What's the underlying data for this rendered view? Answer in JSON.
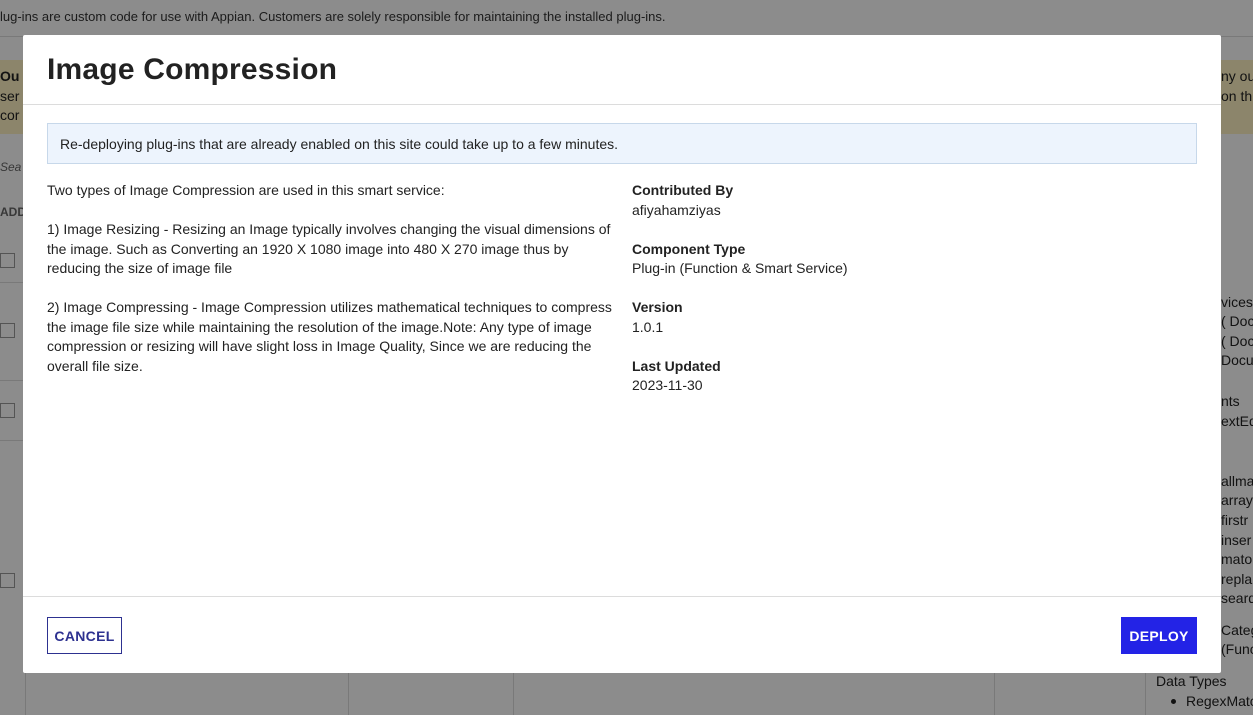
{
  "background": {
    "description": "lug-ins are custom code for use with Appian. Customers are solely responsible for maintaining the installed plug-ins.",
    "left_fragments": [
      "Ou",
      "ser",
      "cor",
      "Sea",
      "ADD"
    ],
    "right_fragments": [
      "ny ou",
      "on thi",
      "vices",
      "( Doc",
      "( Doc",
      "Docu",
      "nts",
      "extEd",
      "allma",
      "array",
      "firstr",
      "inser",
      "mato",
      "repla",
      "seard",
      "Categ",
      "(Func"
    ],
    "data_types_label": "Data Types",
    "data_types_item": "RegexMatc"
  },
  "modal": {
    "title": "Image Compression",
    "info_message": "Re-deploying plug-ins that are already enabled on this site could take up to a few minutes.",
    "description": [
      "Two types of Image Compression are used in this smart service:",
      "1) Image Resizing - Resizing an Image typically involves changing the visual dimensions of the image. Such as Converting an 1920 X 1080 image into 480 X 270 image thus by reducing the size of image file",
      "2) Image Compressing - Image Compression utilizes mathematical techniques to compress the image file size while maintaining the resolution of the image.Note: Any type of image compression or resizing will have slight loss in Image Quality, Since we are reducing the overall file size."
    ],
    "meta": {
      "contributed_by_label": "Contributed By",
      "contributed_by": "afiyahamziyas",
      "component_type_label": "Component Type",
      "component_type": "Plug-in (Function & Smart Service)",
      "version_label": "Version",
      "version": "1.0.1",
      "last_updated_label": "Last Updated",
      "last_updated": "2023-11-30"
    },
    "cancel_label": "CANCEL",
    "deploy_label": "DEPLOY"
  },
  "colors": {
    "primary_button": "#2323e6",
    "secondary_border": "#2d3190",
    "info_background": "#edf4fd",
    "warning_banner": "#fff3c4"
  }
}
